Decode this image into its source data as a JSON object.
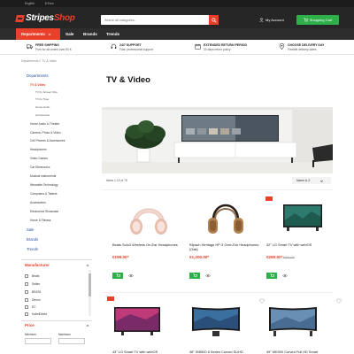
{
  "topbar": {
    "language": "English",
    "currency": "$ Euro"
  },
  "header": {
    "logo_part1": "Stripes",
    "logo_part2": "Shop",
    "search_placeholder": "Search all categories...",
    "account_label": "My Account",
    "cart_label": "Shopping Cart"
  },
  "nav": {
    "departments": "Departments",
    "links": [
      "Sale",
      "Brands",
      "Trends"
    ]
  },
  "features": [
    {
      "title": "FREE SHIPPING",
      "subtitle": "Free for all orders over 50 €",
      "icon": "truck-icon"
    },
    {
      "title": "24/7 SUPPORT",
      "subtitle": "Fast, professional support",
      "icon": "headset-icon"
    },
    {
      "title": "EXTENDED RETURN PERIOD",
      "subtitle": "30 days return policy",
      "icon": "calendar-icon"
    },
    {
      "title": "CHOOSE DELIVERY DAY",
      "subtitle": "Flexible delivery dates",
      "icon": "location-pin-icon"
    }
  ],
  "breadcrumb": "Departments // TV & Video",
  "sidebar": {
    "heading": "Departments",
    "active": "TV & Video",
    "subitems": [
      "TV by Screen Size",
      "TV by Type",
      "Home Audio",
      "Accessories"
    ],
    "items": [
      "Home Audio & Theater",
      "Camera, Photo & Video",
      "Cell Phones & Accessories",
      "Headphones",
      "Video Games",
      "Car Electronics",
      "Musical Instruments",
      "Wearable Technology",
      "Computers & Tablets",
      "Accessories",
      "Electronics Showcase",
      "Home & Fitness"
    ],
    "big_items": [
      "Sale",
      "Brands",
      "Trends"
    ]
  },
  "filters": {
    "manufacturer_title": "Manufacturer",
    "brands": [
      "Beats",
      "Sellen",
      "BEATA",
      "Denon",
      "EC",
      "KabelDirekt"
    ],
    "price_title": "Price",
    "minimum_label": "Minimum",
    "maximum_label": "Maximum"
  },
  "page": {
    "title": "TV & Video",
    "result_count": "Items 1-15 of 75",
    "sort_label": "Name A-Z"
  },
  "products": [
    {
      "name": "Beats Solo3 Wireless On-Ear Headphones",
      "price": "€199.00*",
      "old_price": "",
      "badge": false
    },
    {
      "name": "Klipsch Heritage HP-3 Over-Ear Headphones (Oak)",
      "price": "€1,200.00*",
      "old_price": "",
      "badge": false
    },
    {
      "name": "32\" LG Smart TV with webOS",
      "price": "€280.00*",
      "old_price": "€359.00*",
      "badge": true
    }
  ],
  "next_products": [
    {
      "name": "43\" LG Smart TV with webOS",
      "badge": true
    },
    {
      "name": "48\" ISB500 8 Series Curved SUHD",
      "badge": false
    },
    {
      "name": "49\" MK900 Curved Full HD Smart",
      "badge": false
    }
  ],
  "colors": {
    "accent": "#e8402a",
    "green": "#2faf4a",
    "dark": "#262626",
    "link": "#2a4ea0"
  }
}
